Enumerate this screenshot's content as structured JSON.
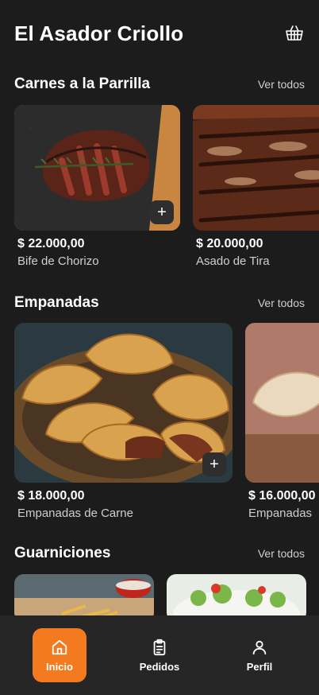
{
  "header": {
    "title": "El Asador Criollo",
    "cart_icon": "basket-icon"
  },
  "sections": [
    {
      "title": "Carnes a la Parrilla",
      "see_all": "Ver todos",
      "items": [
        {
          "price": "$ 22.000,00",
          "name": "Bife de Chorizo"
        },
        {
          "price": "$ 20.000,00",
          "name": "Asado de Tira"
        }
      ]
    },
    {
      "title": "Empanadas",
      "see_all": "Ver todos",
      "items": [
        {
          "price": "$ 18.000,00",
          "name": "Empanadas de Carne"
        },
        {
          "price": "$ 16.000,00",
          "name": "Empanadas"
        }
      ]
    },
    {
      "title": "Guarniciones",
      "see_all": "Ver todos",
      "items": []
    }
  ],
  "add_label": "+",
  "nav": [
    {
      "label": "Inicio",
      "icon": "home-icon",
      "active": true
    },
    {
      "label": "Pedidos",
      "icon": "clipboard-icon",
      "active": false
    },
    {
      "label": "Perfil",
      "icon": "user-icon",
      "active": false
    }
  ],
  "colors": {
    "accent": "#f47a20",
    "background": "#1c1c1c",
    "nav_background": "#262626"
  }
}
